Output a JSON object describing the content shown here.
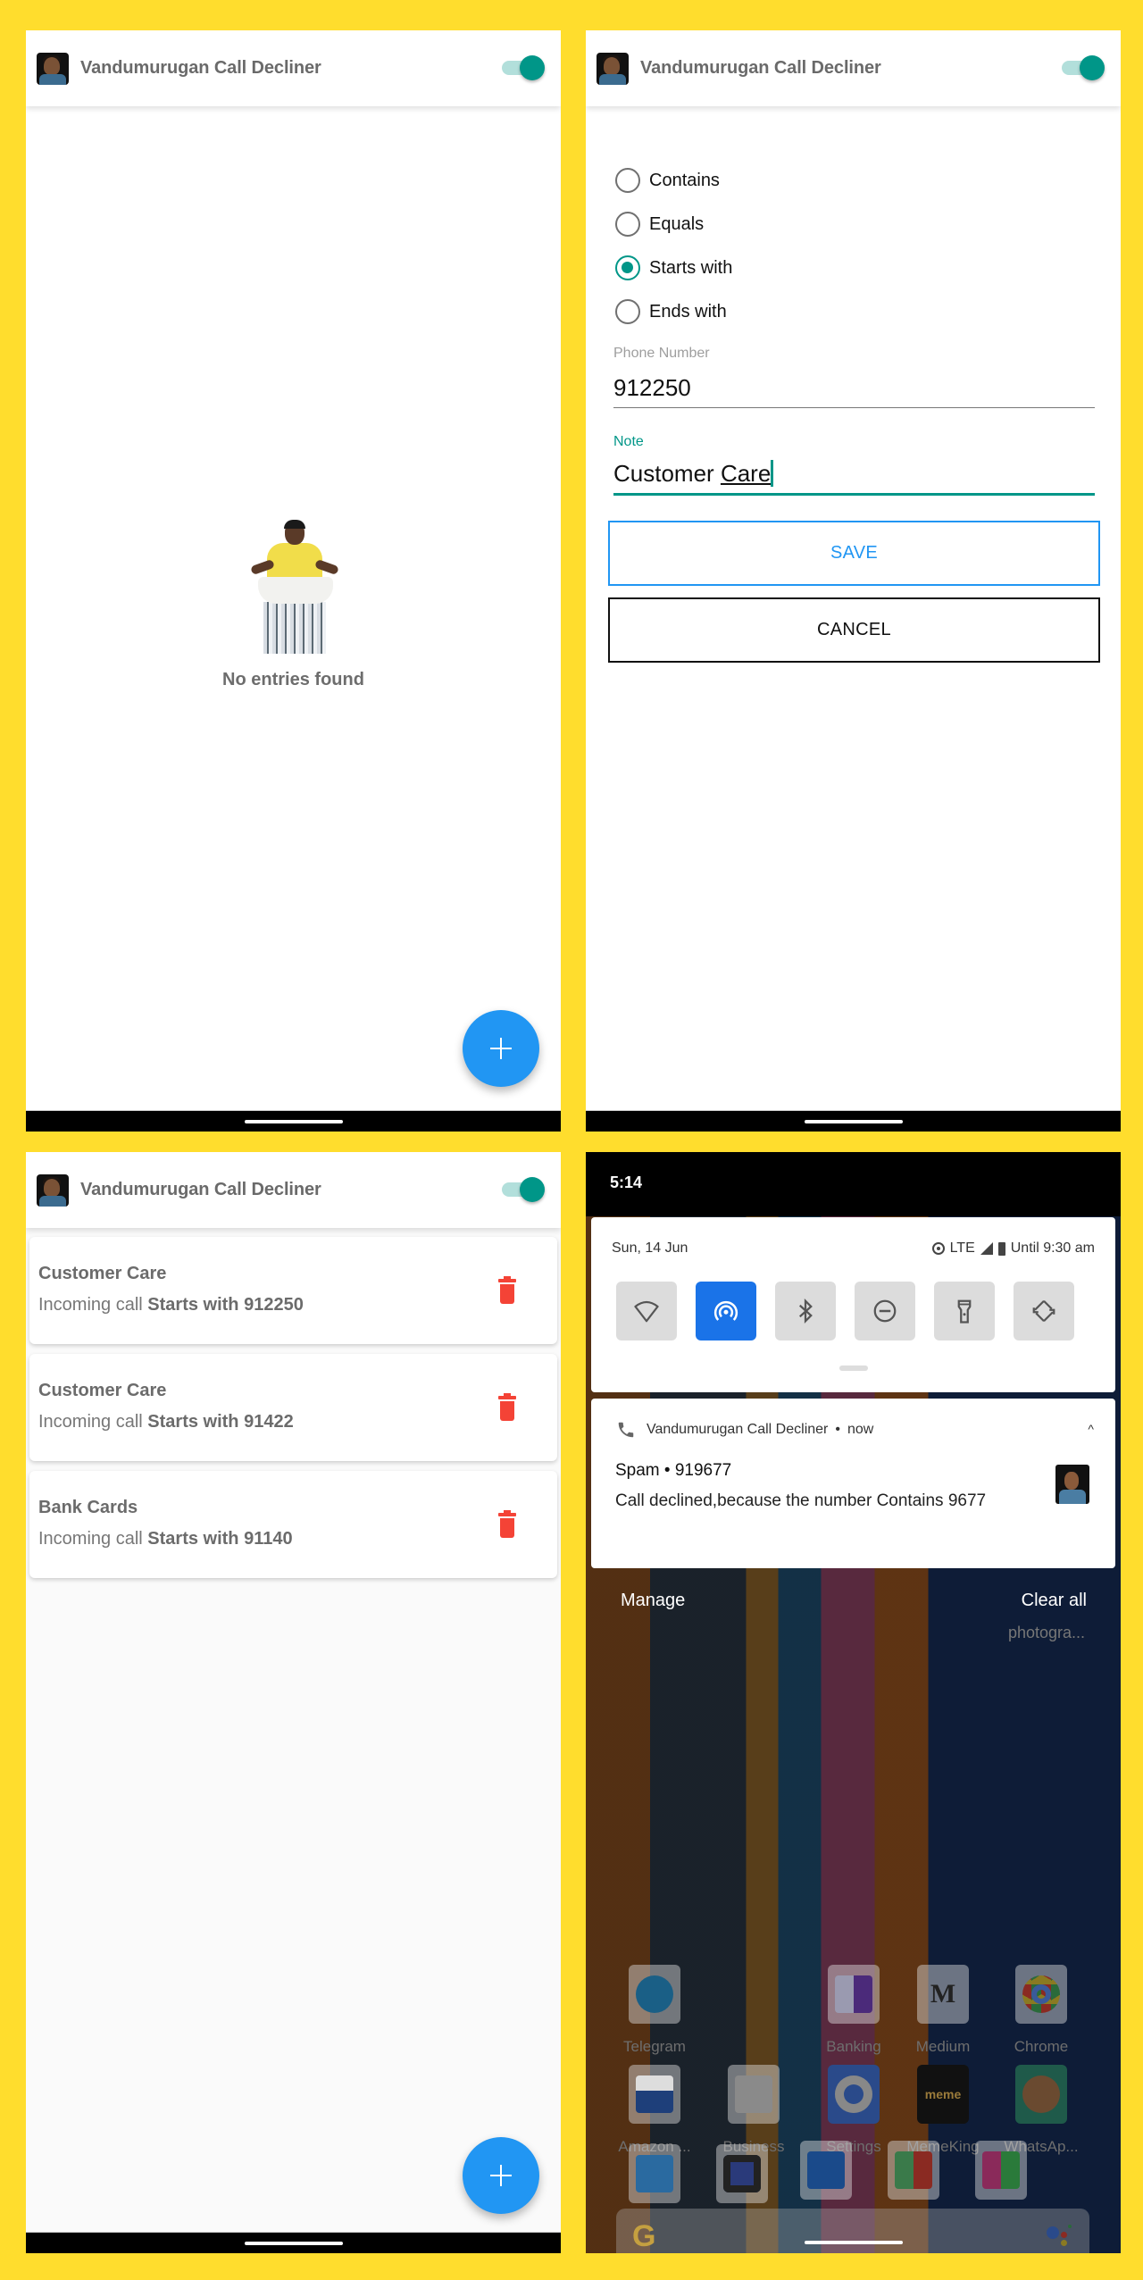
{
  "app": {
    "title": "Vandumurugan Call Decliner",
    "service_enabled": true,
    "colors": {
      "accent": "#009688",
      "fab": "#2196F3",
      "delete": "#F44336",
      "background": "#FFDD2D"
    }
  },
  "empty_screen": {
    "message": "No entries found",
    "fab_icon": "plus-icon"
  },
  "add_screen": {
    "match_options": [
      {
        "label": "Contains",
        "selected": false
      },
      {
        "label": "Equals",
        "selected": false
      },
      {
        "label": "Starts with",
        "selected": true
      },
      {
        "label": "Ends with",
        "selected": false
      }
    ],
    "phone_label": "Phone Number",
    "phone_value": "912250",
    "note_label": "Note",
    "note_value_word1": "Customer",
    "note_value_word2": "Care",
    "save_label": "SAVE",
    "cancel_label": "CANCEL"
  },
  "list_screen": {
    "prefix": "Incoming call",
    "entries": [
      {
        "note": "Customer Care",
        "rule": "Starts with 912250"
      },
      {
        "note": "Customer Care",
        "rule": "Starts with 91422"
      },
      {
        "note": "Bank Cards",
        "rule": "Starts with 91140"
      }
    ]
  },
  "notification_shade": {
    "time": "5:14",
    "date": "Sun, 14 Jun",
    "network": "LTE",
    "battery_text": "Until 9:30 am",
    "tiles": [
      {
        "icon": "wifi-icon",
        "on": false
      },
      {
        "icon": "hotspot-icon",
        "on": true
      },
      {
        "icon": "bluetooth-icon",
        "on": false
      },
      {
        "icon": "do-not-disturb-icon",
        "on": false
      },
      {
        "icon": "flashlight-icon",
        "on": false
      },
      {
        "icon": "auto-rotate-icon",
        "on": false
      }
    ],
    "notification": {
      "app": "Vandumurugan Call Decliner",
      "time": "now",
      "title": "Spam • 919677",
      "body": "Call declined,because the number Contains 9677"
    },
    "manage_label": "Manage",
    "clear_all_label": "Clear all",
    "faded_label": "photogra...",
    "home_apps_row1": [
      "Telegram",
      "Banking",
      "Medium",
      "Chrome"
    ],
    "home_apps_row2": [
      "Amazon ...",
      "Business",
      "Settings",
      "MemeKing",
      "WhatsAp..."
    ]
  }
}
